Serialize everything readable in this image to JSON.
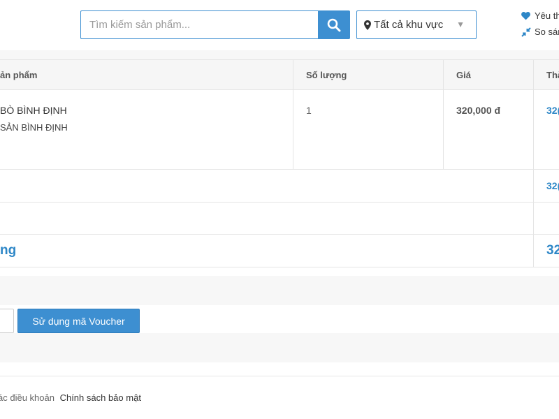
{
  "header": {
    "search": {
      "placeholder": "Tìm kiếm sản phẩm..."
    },
    "region": {
      "label": "Tất cả khu vực"
    },
    "links": {
      "favorites": "Yêu th",
      "compare": "So sán"
    }
  },
  "cart": {
    "columns": {
      "product": "ản phẩm",
      "quantity": "Số lượng",
      "price": "Giá",
      "total": "Thà"
    },
    "item": {
      "name": "BÒ BÌNH ĐỊNH",
      "subtitle": "SẢN BÌNH ĐỊNH",
      "quantity": "1",
      "price": "320,000 đ",
      "total": "32("
    },
    "subtotal": "32(",
    "grand_total_label": "ng",
    "grand_total": "32"
  },
  "voucher": {
    "button_label": "Sử dụng mã Voucher"
  },
  "terms": {
    "conditions": "ác điều khoản",
    "privacy": "Chính sách bảo mật"
  },
  "colors": {
    "accent": "#3d8fd1",
    "highlight_text": "#2e87c7"
  },
  "icons": [
    "search-icon",
    "map-pin-icon",
    "chevron-down-icon",
    "heart-icon",
    "compare-icon"
  ]
}
